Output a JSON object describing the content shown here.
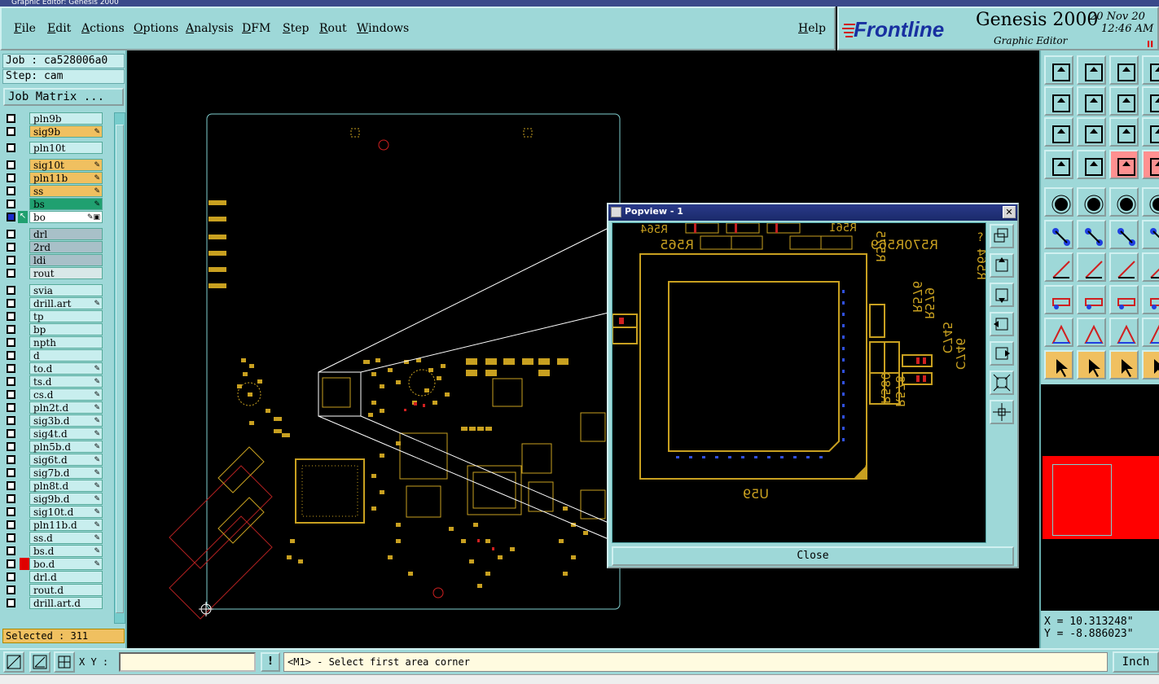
{
  "window": {
    "title": "Graphic Editor: Genesis 2000"
  },
  "menu": [
    {
      "label": "File"
    },
    {
      "label": "Edit"
    },
    {
      "label": "Actions"
    },
    {
      "label": "Options"
    },
    {
      "label": "Analysis"
    },
    {
      "label": "DFM"
    },
    {
      "label": "Step"
    },
    {
      "label": "Rout"
    },
    {
      "label": "Windows"
    },
    {
      "label": "Help"
    }
  ],
  "brand": {
    "logo": "Frontline",
    "product": "Genesis 2000",
    "subtitle": "Graphic Editor",
    "date": "20 Nov 20",
    "time": "12:46 AM",
    "pause": "II"
  },
  "job": {
    "line": "Job : ca528006a0",
    "step": "Step: cam",
    "matrix_button": "Job Matrix ..."
  },
  "layers": [
    {
      "name": "pln9b",
      "color": "#c8eeee",
      "mark": ""
    },
    {
      "name": "sig9b",
      "color": "#f0c060",
      "mark": "✎"
    },
    {
      "name": "pln10t",
      "color": "#c8eeee",
      "mark": ""
    },
    {
      "name": "sig10t",
      "color": "#f0c060",
      "mark": "✎"
    },
    {
      "name": "pln11b",
      "color": "#f0c060",
      "mark": "✎"
    },
    {
      "name": "ss",
      "color": "#f0c060",
      "mark": "✎"
    },
    {
      "name": "bs",
      "color": "#20a070",
      "mark": "✎"
    },
    {
      "name": "bo",
      "color": "#ffffff",
      "mark": "✎▣"
    },
    {
      "name": "drl",
      "color": "#a8c0c8",
      "mark": ""
    },
    {
      "name": "2rd",
      "color": "#a8c0c8",
      "mark": ""
    },
    {
      "name": "ldi",
      "color": "#a8c0c8",
      "mark": ""
    },
    {
      "name": "rout",
      "color": "#d8e8e8",
      "mark": ""
    },
    {
      "name": "svia",
      "color": "#c8eeee",
      "mark": ""
    },
    {
      "name": "drill.art",
      "color": "#c8eeee",
      "mark": "✎"
    },
    {
      "name": "tp",
      "color": "#c8eeee",
      "mark": ""
    },
    {
      "name": "bp",
      "color": "#c8eeee",
      "mark": ""
    },
    {
      "name": "npth",
      "color": "#c8eeee",
      "mark": ""
    },
    {
      "name": "d",
      "color": "#c8eeee",
      "mark": ""
    },
    {
      "name": "to.d",
      "color": "#c8eeee",
      "mark": "✎"
    },
    {
      "name": "ts.d",
      "color": "#c8eeee",
      "mark": "✎"
    },
    {
      "name": "cs.d",
      "color": "#c8eeee",
      "mark": "✎"
    },
    {
      "name": "pln2t.d",
      "color": "#c8eeee",
      "mark": "✎"
    },
    {
      "name": "sig3b.d",
      "color": "#c8eeee",
      "mark": "✎"
    },
    {
      "name": "sig4t.d",
      "color": "#c8eeee",
      "mark": "✎"
    },
    {
      "name": "pln5b.d",
      "color": "#c8eeee",
      "mark": "✎"
    },
    {
      "name": "sig6t.d",
      "color": "#c8eeee",
      "mark": "✎"
    },
    {
      "name": "sig7b.d",
      "color": "#c8eeee",
      "mark": "✎"
    },
    {
      "name": "pln8t.d",
      "color": "#c8eeee",
      "mark": "✎"
    },
    {
      "name": "sig9b.d",
      "color": "#c8eeee",
      "mark": "✎"
    },
    {
      "name": "sig10t.d",
      "color": "#c8eeee",
      "mark": "✎"
    },
    {
      "name": "pln11b.d",
      "color": "#c8eeee",
      "mark": "✎"
    },
    {
      "name": "ss.d",
      "color": "#c8eeee",
      "mark": "✎"
    },
    {
      "name": "bs.d",
      "color": "#c8eeee",
      "mark": "✎"
    },
    {
      "name": "bo.d",
      "color": "#c8eeee",
      "mark": "✎"
    },
    {
      "name": "drl.d",
      "color": "#c8eeee",
      "mark": ""
    },
    {
      "name": "rout.d",
      "color": "#c8eeee",
      "mark": ""
    },
    {
      "name": "drill.art.d",
      "color": "#c8eeee",
      "mark": ""
    }
  ],
  "selected": "Selected : 311",
  "popview": {
    "title": "Popview - 1",
    "close_label": "Close",
    "labels": {
      "r565": "R565",
      "r570_569": "R570R569",
      "r575": "R575",
      "r576": "R576",
      "r579": "R579",
      "c745": "C745",
      "c746": "C746",
      "r580": "R580",
      "r578": "R578",
      "u59": "U59",
      "r564": "R564",
      "r561": "R561",
      "r564b": "R564"
    }
  },
  "coords": {
    "x": "X = 10.313248\"",
    "y": "Y = -8.886023\""
  },
  "bottom": {
    "xy_label": "X Y :",
    "xy_value": "",
    "warn": "!",
    "prompt": "<M1> - Select first area corner",
    "units": "Inch"
  },
  "colors": {
    "panel": "#9ed8d8",
    "copper": "#c8a020",
    "highlight": "#ff0000",
    "outline": "#80d0d0"
  }
}
